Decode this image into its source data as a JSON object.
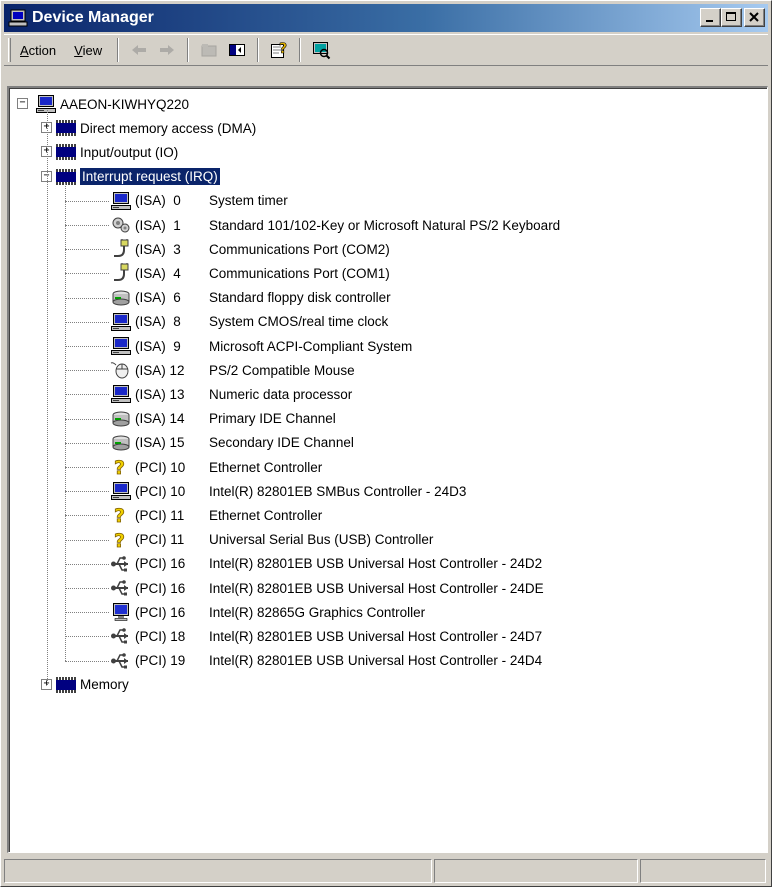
{
  "window": {
    "title": "Device Manager",
    "caption_buttons": [
      "minimize",
      "maximize",
      "close"
    ]
  },
  "menu": {
    "action": {
      "label": "Action",
      "mnemonic": "A",
      "rest": "ction"
    },
    "view": {
      "label": "View",
      "mnemonic": "V",
      "rest": "iew"
    }
  },
  "toolbar": {
    "icons": [
      "back-arrow-icon",
      "forward-arrow-icon",
      "folder-up-icon",
      "show-hide-tree-icon",
      "properties-help-icon",
      "scan-hardware-icon"
    ]
  },
  "tree": {
    "root": "AAEON-KIWHYQ220",
    "categories": [
      {
        "label": "Direct memory access (DMA)",
        "expanded": false
      },
      {
        "label": "Input/output (IO)",
        "expanded": false
      },
      {
        "label": "Interrupt request (IRQ)",
        "expanded": true,
        "selected": true
      },
      {
        "label": "Memory",
        "expanded": false
      }
    ],
    "irq_entries": [
      {
        "irq": "(ISA)  0",
        "device": "System timer",
        "icon": "computer-icon"
      },
      {
        "irq": "(ISA)  1",
        "device": "Standard 101/102-Key or Microsoft Natural PS/2 Keyboard",
        "icon": "keyboard-icon"
      },
      {
        "irq": "(ISA)  3",
        "device": "Communications Port (COM2)",
        "icon": "port-plug-icon"
      },
      {
        "irq": "(ISA)  4",
        "device": "Communications Port (COM1)",
        "icon": "port-plug-icon"
      },
      {
        "irq": "(ISA)  6",
        "device": "Standard floppy disk controller",
        "icon": "disk-controller-icon"
      },
      {
        "irq": "(ISA)  8",
        "device": "System CMOS/real time clock",
        "icon": "computer-icon"
      },
      {
        "irq": "(ISA)  9",
        "device": "Microsoft ACPI-Compliant System",
        "icon": "computer-icon"
      },
      {
        "irq": "(ISA) 12",
        "device": "PS/2 Compatible Mouse",
        "icon": "mouse-icon"
      },
      {
        "irq": "(ISA) 13",
        "device": "Numeric data processor",
        "icon": "computer-icon"
      },
      {
        "irq": "(ISA) 14",
        "device": "Primary IDE Channel",
        "icon": "disk-controller-icon"
      },
      {
        "irq": "(ISA) 15",
        "device": "Secondary IDE Channel",
        "icon": "disk-controller-icon"
      },
      {
        "irq": "(PCI) 10",
        "device": "Ethernet Controller",
        "icon": "unknown-device-icon"
      },
      {
        "irq": "(PCI) 10",
        "device": "Intel(R) 82801EB SMBus Controller - 24D3",
        "icon": "computer-icon"
      },
      {
        "irq": "(PCI) 11",
        "device": "Ethernet Controller",
        "icon": "unknown-device-icon"
      },
      {
        "irq": "(PCI) 11",
        "device": "Universal Serial Bus (USB) Controller",
        "icon": "unknown-device-icon"
      },
      {
        "irq": "(PCI) 16",
        "device": "Intel(R) 82801EB USB Universal Host Controller - 24D2",
        "icon": "usb-icon"
      },
      {
        "irq": "(PCI) 16",
        "device": "Intel(R) 82801EB USB Universal Host Controller - 24DE",
        "icon": "usb-icon"
      },
      {
        "irq": "(PCI) 16",
        "device": "Intel(R) 82865G Graphics Controller",
        "icon": "display-adapter-icon"
      },
      {
        "irq": "(PCI) 18",
        "device": "Intel(R) 82801EB USB Universal Host Controller - 24D7",
        "icon": "usb-icon"
      },
      {
        "irq": "(PCI) 19",
        "device": "Intel(R) 82801EB USB Universal Host Controller - 24D4",
        "icon": "usb-icon"
      }
    ]
  },
  "statusbar": {
    "panes": [
      "",
      "",
      ""
    ]
  },
  "colors": {
    "title_start": "#0a246a",
    "title_end": "#a6caf0",
    "selection": "#0a246a",
    "chip": "#000080",
    "face": "#d4d0c8"
  }
}
